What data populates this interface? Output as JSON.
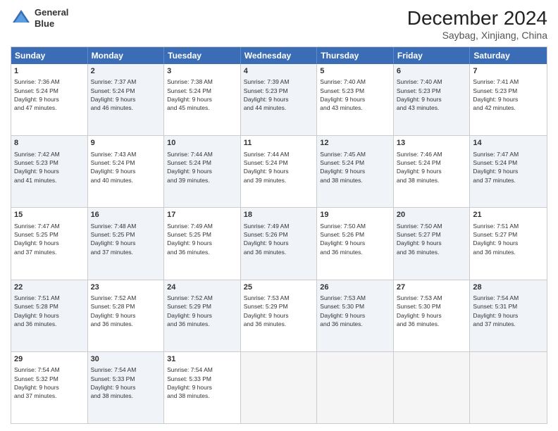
{
  "header": {
    "logo_line1": "General",
    "logo_line2": "Blue",
    "month": "December 2024",
    "location": "Saybag, Xinjiang, China"
  },
  "weekdays": [
    "Sunday",
    "Monday",
    "Tuesday",
    "Wednesday",
    "Thursday",
    "Friday",
    "Saturday"
  ],
  "rows": [
    [
      {
        "day": "1",
        "text": "Sunrise: 7:36 AM\nSunset: 5:24 PM\nDaylight: 9 hours\nand 47 minutes.",
        "empty": false,
        "alt": false
      },
      {
        "day": "2",
        "text": "Sunrise: 7:37 AM\nSunset: 5:24 PM\nDaylight: 9 hours\nand 46 minutes.",
        "empty": false,
        "alt": true
      },
      {
        "day": "3",
        "text": "Sunrise: 7:38 AM\nSunset: 5:24 PM\nDaylight: 9 hours\nand 45 minutes.",
        "empty": false,
        "alt": false
      },
      {
        "day": "4",
        "text": "Sunrise: 7:39 AM\nSunset: 5:23 PM\nDaylight: 9 hours\nand 44 minutes.",
        "empty": false,
        "alt": true
      },
      {
        "day": "5",
        "text": "Sunrise: 7:40 AM\nSunset: 5:23 PM\nDaylight: 9 hours\nand 43 minutes.",
        "empty": false,
        "alt": false
      },
      {
        "day": "6",
        "text": "Sunrise: 7:40 AM\nSunset: 5:23 PM\nDaylight: 9 hours\nand 43 minutes.",
        "empty": false,
        "alt": true
      },
      {
        "day": "7",
        "text": "Sunrise: 7:41 AM\nSunset: 5:23 PM\nDaylight: 9 hours\nand 42 minutes.",
        "empty": false,
        "alt": false
      }
    ],
    [
      {
        "day": "8",
        "text": "Sunrise: 7:42 AM\nSunset: 5:23 PM\nDaylight: 9 hours\nand 41 minutes.",
        "empty": false,
        "alt": true
      },
      {
        "day": "9",
        "text": "Sunrise: 7:43 AM\nSunset: 5:24 PM\nDaylight: 9 hours\nand 40 minutes.",
        "empty": false,
        "alt": false
      },
      {
        "day": "10",
        "text": "Sunrise: 7:44 AM\nSunset: 5:24 PM\nDaylight: 9 hours\nand 39 minutes.",
        "empty": false,
        "alt": true
      },
      {
        "day": "11",
        "text": "Sunrise: 7:44 AM\nSunset: 5:24 PM\nDaylight: 9 hours\nand 39 minutes.",
        "empty": false,
        "alt": false
      },
      {
        "day": "12",
        "text": "Sunrise: 7:45 AM\nSunset: 5:24 PM\nDaylight: 9 hours\nand 38 minutes.",
        "empty": false,
        "alt": true
      },
      {
        "day": "13",
        "text": "Sunrise: 7:46 AM\nSunset: 5:24 PM\nDaylight: 9 hours\nand 38 minutes.",
        "empty": false,
        "alt": false
      },
      {
        "day": "14",
        "text": "Sunrise: 7:47 AM\nSunset: 5:24 PM\nDaylight: 9 hours\nand 37 minutes.",
        "empty": false,
        "alt": true
      }
    ],
    [
      {
        "day": "15",
        "text": "Sunrise: 7:47 AM\nSunset: 5:25 PM\nDaylight: 9 hours\nand 37 minutes.",
        "empty": false,
        "alt": false
      },
      {
        "day": "16",
        "text": "Sunrise: 7:48 AM\nSunset: 5:25 PM\nDaylight: 9 hours\nand 37 minutes.",
        "empty": false,
        "alt": true
      },
      {
        "day": "17",
        "text": "Sunrise: 7:49 AM\nSunset: 5:25 PM\nDaylight: 9 hours\nand 36 minutes.",
        "empty": false,
        "alt": false
      },
      {
        "day": "18",
        "text": "Sunrise: 7:49 AM\nSunset: 5:26 PM\nDaylight: 9 hours\nand 36 minutes.",
        "empty": false,
        "alt": true
      },
      {
        "day": "19",
        "text": "Sunrise: 7:50 AM\nSunset: 5:26 PM\nDaylight: 9 hours\nand 36 minutes.",
        "empty": false,
        "alt": false
      },
      {
        "day": "20",
        "text": "Sunrise: 7:50 AM\nSunset: 5:27 PM\nDaylight: 9 hours\nand 36 minutes.",
        "empty": false,
        "alt": true
      },
      {
        "day": "21",
        "text": "Sunrise: 7:51 AM\nSunset: 5:27 PM\nDaylight: 9 hours\nand 36 minutes.",
        "empty": false,
        "alt": false
      }
    ],
    [
      {
        "day": "22",
        "text": "Sunrise: 7:51 AM\nSunset: 5:28 PM\nDaylight: 9 hours\nand 36 minutes.",
        "empty": false,
        "alt": true
      },
      {
        "day": "23",
        "text": "Sunrise: 7:52 AM\nSunset: 5:28 PM\nDaylight: 9 hours\nand 36 minutes.",
        "empty": false,
        "alt": false
      },
      {
        "day": "24",
        "text": "Sunrise: 7:52 AM\nSunset: 5:29 PM\nDaylight: 9 hours\nand 36 minutes.",
        "empty": false,
        "alt": true
      },
      {
        "day": "25",
        "text": "Sunrise: 7:53 AM\nSunset: 5:29 PM\nDaylight: 9 hours\nand 36 minutes.",
        "empty": false,
        "alt": false
      },
      {
        "day": "26",
        "text": "Sunrise: 7:53 AM\nSunset: 5:30 PM\nDaylight: 9 hours\nand 36 minutes.",
        "empty": false,
        "alt": true
      },
      {
        "day": "27",
        "text": "Sunrise: 7:53 AM\nSunset: 5:30 PM\nDaylight: 9 hours\nand 36 minutes.",
        "empty": false,
        "alt": false
      },
      {
        "day": "28",
        "text": "Sunrise: 7:54 AM\nSunset: 5:31 PM\nDaylight: 9 hours\nand 37 minutes.",
        "empty": false,
        "alt": true
      }
    ],
    [
      {
        "day": "29",
        "text": "Sunrise: 7:54 AM\nSunset: 5:32 PM\nDaylight: 9 hours\nand 37 minutes.",
        "empty": false,
        "alt": false
      },
      {
        "day": "30",
        "text": "Sunrise: 7:54 AM\nSunset: 5:33 PM\nDaylight: 9 hours\nand 38 minutes.",
        "empty": false,
        "alt": true
      },
      {
        "day": "31",
        "text": "Sunrise: 7:54 AM\nSunset: 5:33 PM\nDaylight: 9 hours\nand 38 minutes.",
        "empty": false,
        "alt": false
      },
      {
        "day": "",
        "text": "",
        "empty": true,
        "alt": false
      },
      {
        "day": "",
        "text": "",
        "empty": true,
        "alt": false
      },
      {
        "day": "",
        "text": "",
        "empty": true,
        "alt": false
      },
      {
        "day": "",
        "text": "",
        "empty": true,
        "alt": false
      }
    ]
  ]
}
